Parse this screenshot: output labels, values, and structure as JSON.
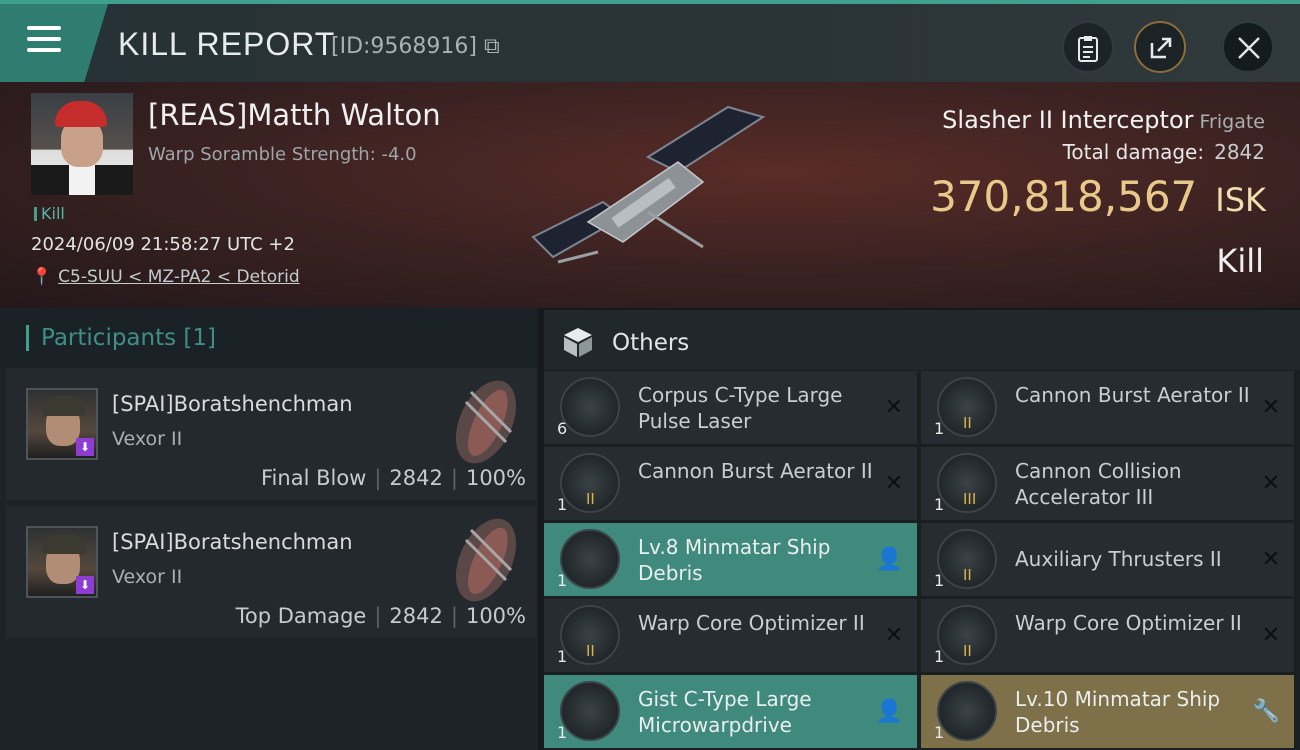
{
  "header": {
    "title": "KILL REPORT",
    "report_id": "[ID:9568916]",
    "menu_icon": "hamburger-menu-icon",
    "buttons": [
      "clipboard-icon",
      "export-icon",
      "close-icon"
    ]
  },
  "victim": {
    "name": "[REAS]Matth Walton",
    "subtitle": "Warp Soramble Strength: -4.0",
    "tag": "Kill",
    "datetime": "2024/06/09 21:58:27 UTC +2",
    "location": "C5-SUU < MZ-PA2 < Detorid",
    "ship_name": "Slasher II Interceptor",
    "ship_class": "Frigate",
    "total_damage_label": "Total damage:",
    "total_damage": "2842",
    "isk_value": "370,818,567",
    "isk_unit": "ISK",
    "result": "Kill"
  },
  "participants": {
    "header": "Participants [1]",
    "items": [
      {
        "name": "[SPAI]Boratshenchman",
        "ship": "Vexor II",
        "role": "Final Blow",
        "damage": "2842",
        "percent": "100%"
      },
      {
        "name": "[SPAI]Boratshenchman",
        "ship": "Vexor II",
        "role": "Top Damage",
        "damage": "2842",
        "percent": "100%"
      }
    ]
  },
  "others": {
    "header": "Others",
    "items": [
      {
        "name": "Corpus C-Type Large Pulse Laser",
        "qty": "6",
        "meta": "",
        "state": "destroyed",
        "action": "✕"
      },
      {
        "name": "Cannon Burst Aerator II",
        "qty": "1",
        "meta": "II",
        "state": "destroyed",
        "action": "✕"
      },
      {
        "name": "Cannon Burst Aerator II",
        "qty": "1",
        "meta": "II",
        "state": "destroyed",
        "action": "✕"
      },
      {
        "name": "Cannon Collision Accelerator III",
        "qty": "1",
        "meta": "III",
        "state": "destroyed",
        "action": "✕"
      },
      {
        "name": "Lv.8 Minmatar Ship Debris",
        "qty": "1",
        "meta": "",
        "state": "dropped",
        "action": "👤"
      },
      {
        "name": "Auxiliary Thrusters II",
        "qty": "1",
        "meta": "II",
        "state": "destroyed",
        "action": "✕"
      },
      {
        "name": "Warp Core Optimizer II",
        "qty": "1",
        "meta": "II",
        "state": "destroyed",
        "action": "✕"
      },
      {
        "name": "Warp Core Optimizer II",
        "qty": "1",
        "meta": "II",
        "state": "destroyed",
        "action": "✕"
      },
      {
        "name": "Gist C-Type Large Microwarpdrive",
        "qty": "1",
        "meta": "",
        "state": "dropped",
        "action": "👤"
      },
      {
        "name": "Lv.10 Minmatar Ship Debris",
        "qty": "1",
        "meta": "",
        "state": "salvage",
        "action": "🔧"
      }
    ]
  },
  "colors": {
    "accent": "#3fa08e",
    "isk": "#e9c98a",
    "dropped": "#3f8a7d",
    "salvage": "#7e7049"
  }
}
